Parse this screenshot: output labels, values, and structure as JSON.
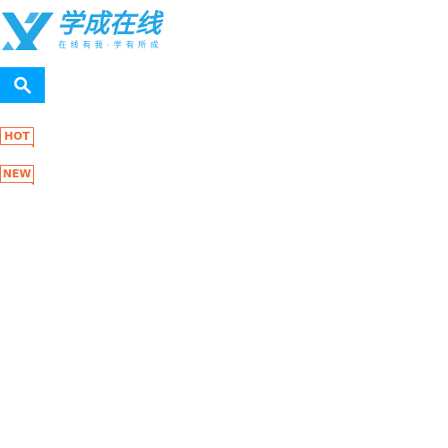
{
  "logo": {
    "icon": "xuecheng-x-logo-icon",
    "title": "学成在线",
    "slogan": "在线有我·学有所成"
  },
  "search": {
    "icon": "search-icon",
    "color": "#00a4ff"
  },
  "tags": {
    "hot": "HOT",
    "new": "NEW",
    "color": "#f26c32"
  },
  "colors": {
    "brand": "#22a6e6",
    "accent": "#00a4ff",
    "tag": "#f26c32"
  }
}
